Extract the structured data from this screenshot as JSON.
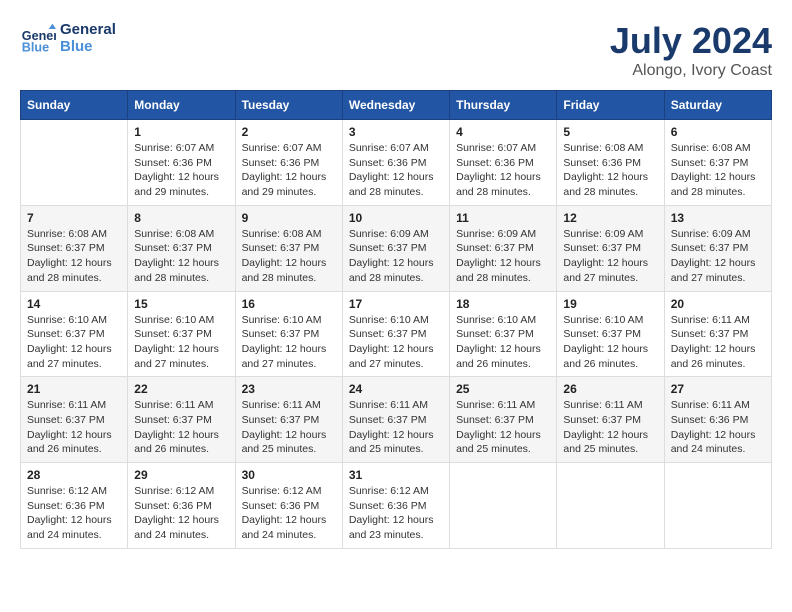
{
  "header": {
    "logo_line1": "General",
    "logo_line2": "Blue",
    "main_title": "July 2024",
    "subtitle": "Alongo, Ivory Coast"
  },
  "days_of_week": [
    "Sunday",
    "Monday",
    "Tuesday",
    "Wednesday",
    "Thursday",
    "Friday",
    "Saturday"
  ],
  "weeks": [
    [
      {
        "day": "",
        "info": ""
      },
      {
        "day": "1",
        "info": "Sunrise: 6:07 AM\nSunset: 6:36 PM\nDaylight: 12 hours\nand 29 minutes."
      },
      {
        "day": "2",
        "info": "Sunrise: 6:07 AM\nSunset: 6:36 PM\nDaylight: 12 hours\nand 29 minutes."
      },
      {
        "day": "3",
        "info": "Sunrise: 6:07 AM\nSunset: 6:36 PM\nDaylight: 12 hours\nand 28 minutes."
      },
      {
        "day": "4",
        "info": "Sunrise: 6:07 AM\nSunset: 6:36 PM\nDaylight: 12 hours\nand 28 minutes."
      },
      {
        "day": "5",
        "info": "Sunrise: 6:08 AM\nSunset: 6:36 PM\nDaylight: 12 hours\nand 28 minutes."
      },
      {
        "day": "6",
        "info": "Sunrise: 6:08 AM\nSunset: 6:37 PM\nDaylight: 12 hours\nand 28 minutes."
      }
    ],
    [
      {
        "day": "7",
        "info": "Sunrise: 6:08 AM\nSunset: 6:37 PM\nDaylight: 12 hours\nand 28 minutes."
      },
      {
        "day": "8",
        "info": "Sunrise: 6:08 AM\nSunset: 6:37 PM\nDaylight: 12 hours\nand 28 minutes."
      },
      {
        "day": "9",
        "info": "Sunrise: 6:08 AM\nSunset: 6:37 PM\nDaylight: 12 hours\nand 28 minutes."
      },
      {
        "day": "10",
        "info": "Sunrise: 6:09 AM\nSunset: 6:37 PM\nDaylight: 12 hours\nand 28 minutes."
      },
      {
        "day": "11",
        "info": "Sunrise: 6:09 AM\nSunset: 6:37 PM\nDaylight: 12 hours\nand 28 minutes."
      },
      {
        "day": "12",
        "info": "Sunrise: 6:09 AM\nSunset: 6:37 PM\nDaylight: 12 hours\nand 27 minutes."
      },
      {
        "day": "13",
        "info": "Sunrise: 6:09 AM\nSunset: 6:37 PM\nDaylight: 12 hours\nand 27 minutes."
      }
    ],
    [
      {
        "day": "14",
        "info": "Sunrise: 6:10 AM\nSunset: 6:37 PM\nDaylight: 12 hours\nand 27 minutes."
      },
      {
        "day": "15",
        "info": "Sunrise: 6:10 AM\nSunset: 6:37 PM\nDaylight: 12 hours\nand 27 minutes."
      },
      {
        "day": "16",
        "info": "Sunrise: 6:10 AM\nSunset: 6:37 PM\nDaylight: 12 hours\nand 27 minutes."
      },
      {
        "day": "17",
        "info": "Sunrise: 6:10 AM\nSunset: 6:37 PM\nDaylight: 12 hours\nand 27 minutes."
      },
      {
        "day": "18",
        "info": "Sunrise: 6:10 AM\nSunset: 6:37 PM\nDaylight: 12 hours\nand 26 minutes."
      },
      {
        "day": "19",
        "info": "Sunrise: 6:10 AM\nSunset: 6:37 PM\nDaylight: 12 hours\nand 26 minutes."
      },
      {
        "day": "20",
        "info": "Sunrise: 6:11 AM\nSunset: 6:37 PM\nDaylight: 12 hours\nand 26 minutes."
      }
    ],
    [
      {
        "day": "21",
        "info": "Sunrise: 6:11 AM\nSunset: 6:37 PM\nDaylight: 12 hours\nand 26 minutes."
      },
      {
        "day": "22",
        "info": "Sunrise: 6:11 AM\nSunset: 6:37 PM\nDaylight: 12 hours\nand 26 minutes."
      },
      {
        "day": "23",
        "info": "Sunrise: 6:11 AM\nSunset: 6:37 PM\nDaylight: 12 hours\nand 25 minutes."
      },
      {
        "day": "24",
        "info": "Sunrise: 6:11 AM\nSunset: 6:37 PM\nDaylight: 12 hours\nand 25 minutes."
      },
      {
        "day": "25",
        "info": "Sunrise: 6:11 AM\nSunset: 6:37 PM\nDaylight: 12 hours\nand 25 minutes."
      },
      {
        "day": "26",
        "info": "Sunrise: 6:11 AM\nSunset: 6:37 PM\nDaylight: 12 hours\nand 25 minutes."
      },
      {
        "day": "27",
        "info": "Sunrise: 6:11 AM\nSunset: 6:36 PM\nDaylight: 12 hours\nand 24 minutes."
      }
    ],
    [
      {
        "day": "28",
        "info": "Sunrise: 6:12 AM\nSunset: 6:36 PM\nDaylight: 12 hours\nand 24 minutes."
      },
      {
        "day": "29",
        "info": "Sunrise: 6:12 AM\nSunset: 6:36 PM\nDaylight: 12 hours\nand 24 minutes."
      },
      {
        "day": "30",
        "info": "Sunrise: 6:12 AM\nSunset: 6:36 PM\nDaylight: 12 hours\nand 24 minutes."
      },
      {
        "day": "31",
        "info": "Sunrise: 6:12 AM\nSunset: 6:36 PM\nDaylight: 12 hours\nand 23 minutes."
      },
      {
        "day": "",
        "info": ""
      },
      {
        "day": "",
        "info": ""
      },
      {
        "day": "",
        "info": ""
      }
    ]
  ]
}
